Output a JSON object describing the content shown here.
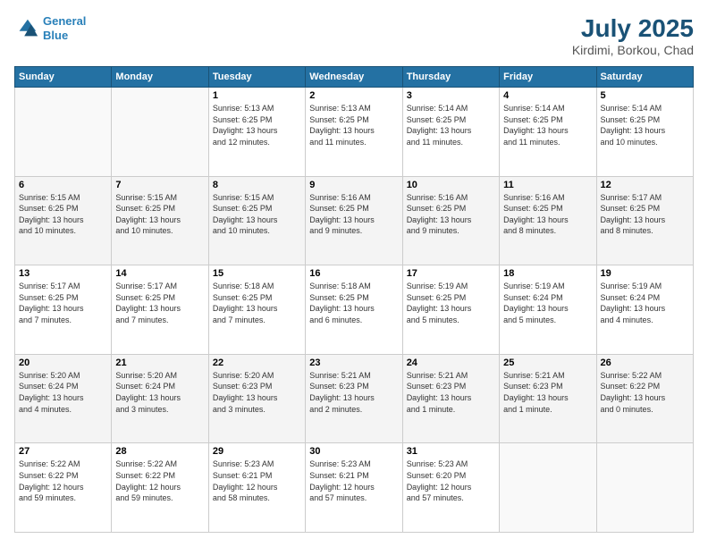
{
  "header": {
    "logo_line1": "General",
    "logo_line2": "Blue",
    "title": "July 2025",
    "subtitle": "Kirdimi, Borkou, Chad"
  },
  "days_of_week": [
    "Sunday",
    "Monday",
    "Tuesday",
    "Wednesday",
    "Thursday",
    "Friday",
    "Saturday"
  ],
  "weeks": [
    [
      {
        "day": "",
        "info": ""
      },
      {
        "day": "",
        "info": ""
      },
      {
        "day": "1",
        "info": "Sunrise: 5:13 AM\nSunset: 6:25 PM\nDaylight: 13 hours\nand 12 minutes."
      },
      {
        "day": "2",
        "info": "Sunrise: 5:13 AM\nSunset: 6:25 PM\nDaylight: 13 hours\nand 11 minutes."
      },
      {
        "day": "3",
        "info": "Sunrise: 5:14 AM\nSunset: 6:25 PM\nDaylight: 13 hours\nand 11 minutes."
      },
      {
        "day": "4",
        "info": "Sunrise: 5:14 AM\nSunset: 6:25 PM\nDaylight: 13 hours\nand 11 minutes."
      },
      {
        "day": "5",
        "info": "Sunrise: 5:14 AM\nSunset: 6:25 PM\nDaylight: 13 hours\nand 10 minutes."
      }
    ],
    [
      {
        "day": "6",
        "info": "Sunrise: 5:15 AM\nSunset: 6:25 PM\nDaylight: 13 hours\nand 10 minutes."
      },
      {
        "day": "7",
        "info": "Sunrise: 5:15 AM\nSunset: 6:25 PM\nDaylight: 13 hours\nand 10 minutes."
      },
      {
        "day": "8",
        "info": "Sunrise: 5:15 AM\nSunset: 6:25 PM\nDaylight: 13 hours\nand 10 minutes."
      },
      {
        "day": "9",
        "info": "Sunrise: 5:16 AM\nSunset: 6:25 PM\nDaylight: 13 hours\nand 9 minutes."
      },
      {
        "day": "10",
        "info": "Sunrise: 5:16 AM\nSunset: 6:25 PM\nDaylight: 13 hours\nand 9 minutes."
      },
      {
        "day": "11",
        "info": "Sunrise: 5:16 AM\nSunset: 6:25 PM\nDaylight: 13 hours\nand 8 minutes."
      },
      {
        "day": "12",
        "info": "Sunrise: 5:17 AM\nSunset: 6:25 PM\nDaylight: 13 hours\nand 8 minutes."
      }
    ],
    [
      {
        "day": "13",
        "info": "Sunrise: 5:17 AM\nSunset: 6:25 PM\nDaylight: 13 hours\nand 7 minutes."
      },
      {
        "day": "14",
        "info": "Sunrise: 5:17 AM\nSunset: 6:25 PM\nDaylight: 13 hours\nand 7 minutes."
      },
      {
        "day": "15",
        "info": "Sunrise: 5:18 AM\nSunset: 6:25 PM\nDaylight: 13 hours\nand 7 minutes."
      },
      {
        "day": "16",
        "info": "Sunrise: 5:18 AM\nSunset: 6:25 PM\nDaylight: 13 hours\nand 6 minutes."
      },
      {
        "day": "17",
        "info": "Sunrise: 5:19 AM\nSunset: 6:25 PM\nDaylight: 13 hours\nand 5 minutes."
      },
      {
        "day": "18",
        "info": "Sunrise: 5:19 AM\nSunset: 6:24 PM\nDaylight: 13 hours\nand 5 minutes."
      },
      {
        "day": "19",
        "info": "Sunrise: 5:19 AM\nSunset: 6:24 PM\nDaylight: 13 hours\nand 4 minutes."
      }
    ],
    [
      {
        "day": "20",
        "info": "Sunrise: 5:20 AM\nSunset: 6:24 PM\nDaylight: 13 hours\nand 4 minutes."
      },
      {
        "day": "21",
        "info": "Sunrise: 5:20 AM\nSunset: 6:24 PM\nDaylight: 13 hours\nand 3 minutes."
      },
      {
        "day": "22",
        "info": "Sunrise: 5:20 AM\nSunset: 6:23 PM\nDaylight: 13 hours\nand 3 minutes."
      },
      {
        "day": "23",
        "info": "Sunrise: 5:21 AM\nSunset: 6:23 PM\nDaylight: 13 hours\nand 2 minutes."
      },
      {
        "day": "24",
        "info": "Sunrise: 5:21 AM\nSunset: 6:23 PM\nDaylight: 13 hours\nand 1 minute."
      },
      {
        "day": "25",
        "info": "Sunrise: 5:21 AM\nSunset: 6:23 PM\nDaylight: 13 hours\nand 1 minute."
      },
      {
        "day": "26",
        "info": "Sunrise: 5:22 AM\nSunset: 6:22 PM\nDaylight: 13 hours\nand 0 minutes."
      }
    ],
    [
      {
        "day": "27",
        "info": "Sunrise: 5:22 AM\nSunset: 6:22 PM\nDaylight: 12 hours\nand 59 minutes."
      },
      {
        "day": "28",
        "info": "Sunrise: 5:22 AM\nSunset: 6:22 PM\nDaylight: 12 hours\nand 59 minutes."
      },
      {
        "day": "29",
        "info": "Sunrise: 5:23 AM\nSunset: 6:21 PM\nDaylight: 12 hours\nand 58 minutes."
      },
      {
        "day": "30",
        "info": "Sunrise: 5:23 AM\nSunset: 6:21 PM\nDaylight: 12 hours\nand 57 minutes."
      },
      {
        "day": "31",
        "info": "Sunrise: 5:23 AM\nSunset: 6:20 PM\nDaylight: 12 hours\nand 57 minutes."
      },
      {
        "day": "",
        "info": ""
      },
      {
        "day": "",
        "info": ""
      }
    ]
  ]
}
